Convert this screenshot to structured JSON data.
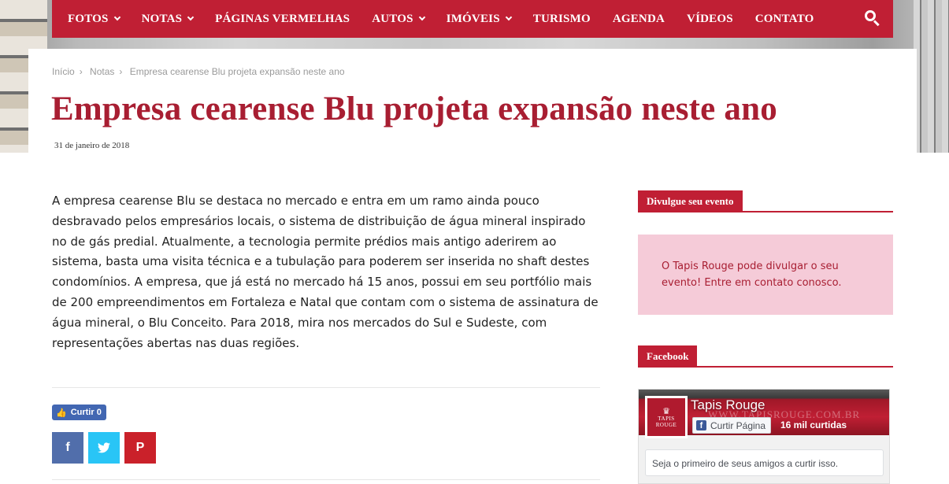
{
  "nav": {
    "items": [
      {
        "label": "FOTOS",
        "dropdown": true
      },
      {
        "label": "NOTAS",
        "dropdown": true
      },
      {
        "label": "PÁGINAS VERMELHAS",
        "dropdown": false
      },
      {
        "label": "AUTOS",
        "dropdown": true
      },
      {
        "label": "IMÓVEIS",
        "dropdown": true
      },
      {
        "label": "TURISMO",
        "dropdown": false
      },
      {
        "label": "AGENDA",
        "dropdown": false
      },
      {
        "label": "VÍDEOS",
        "dropdown": false
      },
      {
        "label": "CONTATO",
        "dropdown": false
      }
    ],
    "search_icon": "search-icon"
  },
  "breadcrumb": {
    "items": [
      "Início",
      "Notas",
      "Empresa cearense Blu projeta expansão neste ano"
    ],
    "separator": "›"
  },
  "article": {
    "title": "Empresa cearense Blu projeta expansão neste ano",
    "date": "31 de janeiro de 2018",
    "body": "A empresa cearense Blu se destaca no mercado e entra em um ramo ainda pouco desbravado pelos empresários locais, o sistema de distribuição de água mineral inspirado no de gás predial. Atualmente, a tecnologia permite prédios mais antigo aderirem ao sistema, basta uma visita técnica e a tubulação para poderem ser inserida no shaft destes condomínios. A empresa, que já está no mercado há 15 anos, possui em seu portfólio mais de 200 empreendimentos em Fortaleza e Natal que contam com o sistema de assinatura de água mineral, o Blu Conceito. Para 2018, mira nos mercados do Sul e Sudeste, com representações abertas nas duas regiões.",
    "like_label": "Curtir 0",
    "share": {
      "facebook": "f",
      "twitter": "twitter-bird-icon",
      "pinterest": "P"
    }
  },
  "sidebar": {
    "event_widget": {
      "title": "Divulgue seu evento",
      "text": "O Tapis Rouge pode divulgar o seu evento! Entre em contato conosco."
    },
    "facebook_widget": {
      "title": "Facebook",
      "page_name": "Tapis Rouge",
      "watermark": "WWW.TAPISROUGE.COM.BR",
      "avatar_text": "TAPIS ROUGE",
      "like_button": "Curtir Página",
      "likes_count": "16 mil curtidas",
      "friends_text": "Seja o primeiro de seus amigos a curtir isso."
    }
  },
  "colors": {
    "brand_red": "#c01f34",
    "title_red": "#a81e32",
    "event_bg": "#f5cbd8",
    "facebook_blue": "#516eab",
    "twitter_blue": "#29c5f6",
    "pinterest_red": "#ca212a"
  }
}
